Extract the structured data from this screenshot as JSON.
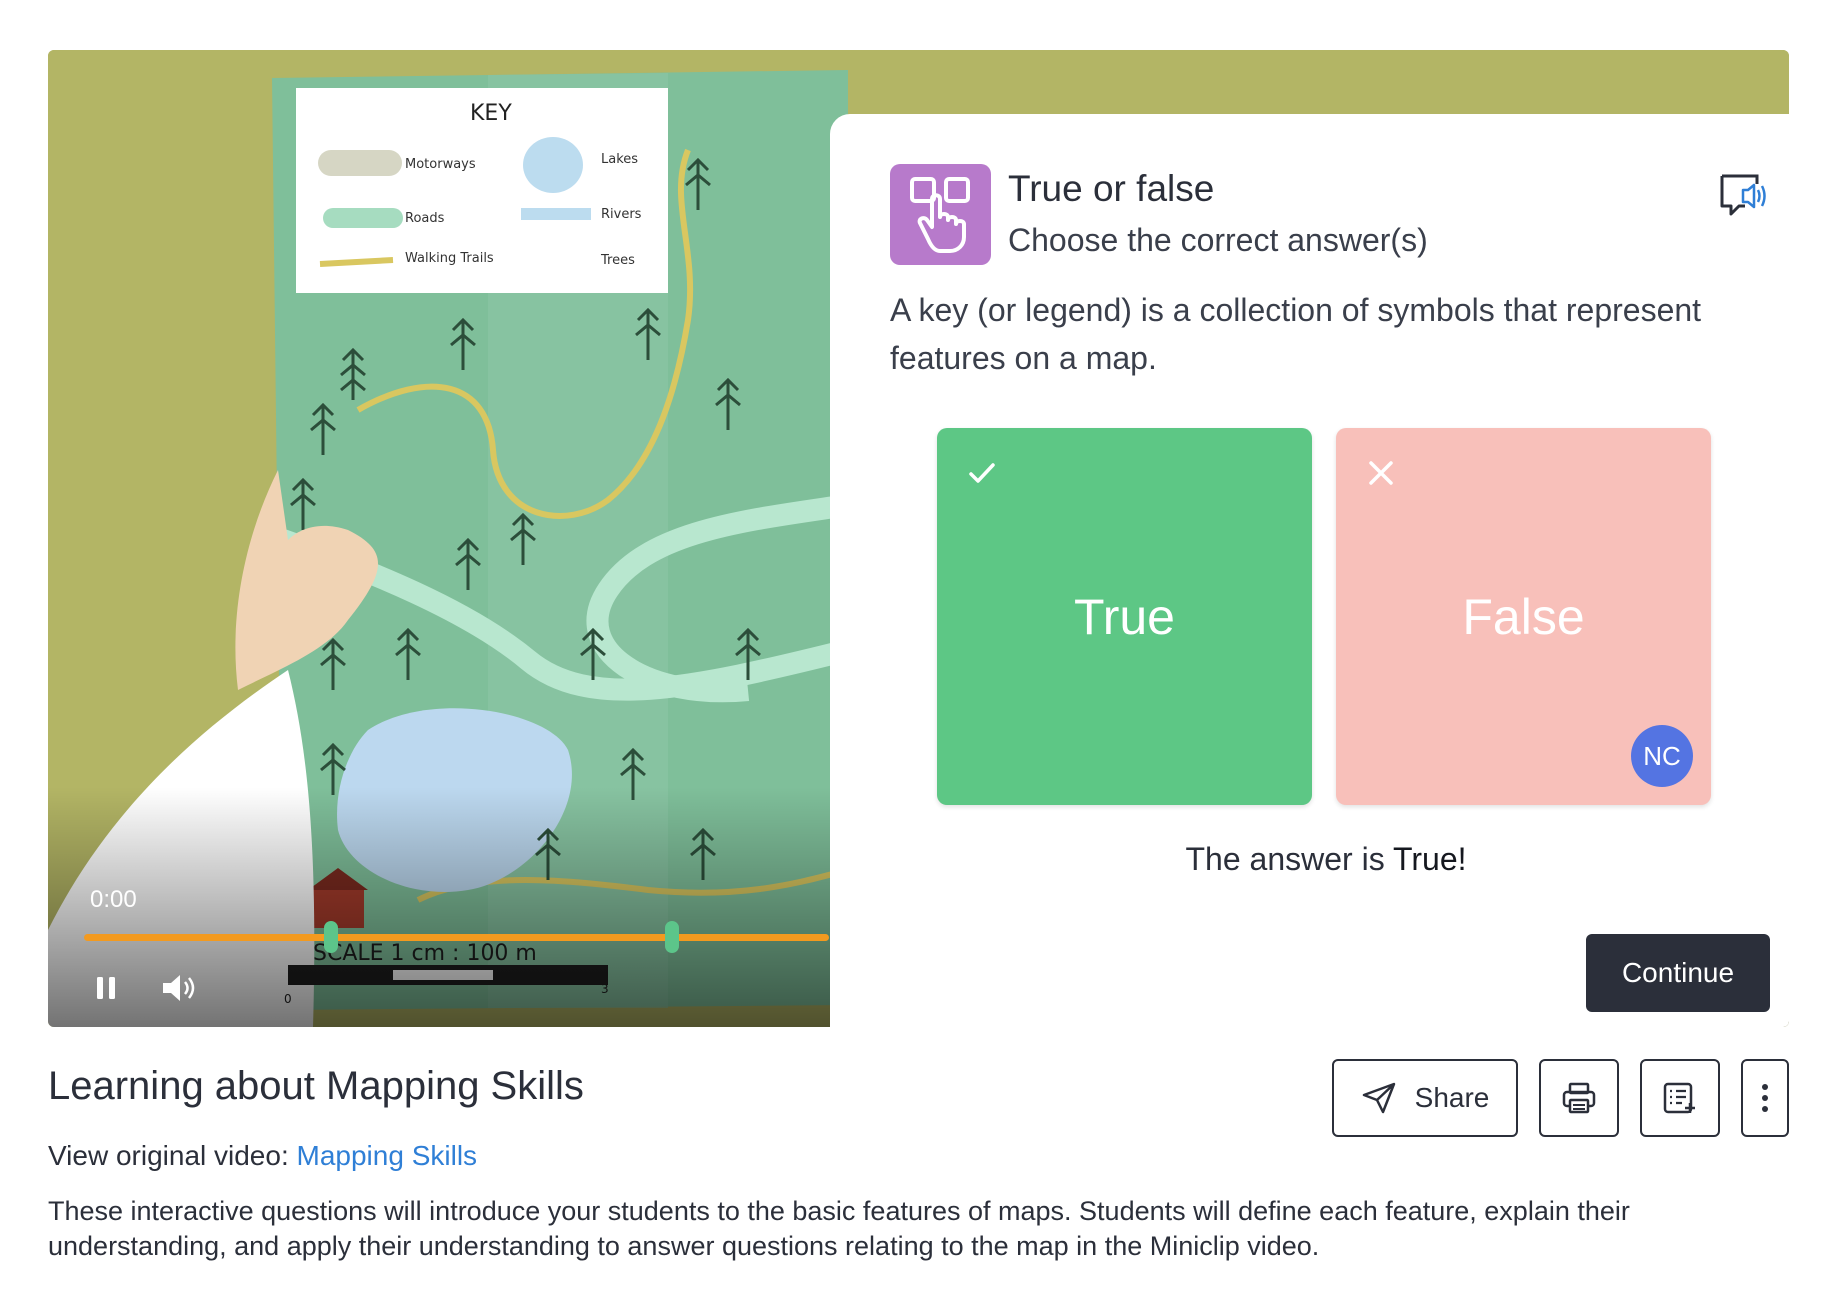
{
  "player": {
    "current_time": "0:00",
    "progress": 0,
    "question_markers": 2,
    "controls": {
      "pause_icon": "pause-icon",
      "volume_icon": "volume-icon"
    },
    "map_key": {
      "heading": "KEY",
      "items": [
        "Motorways",
        "Lakes",
        "Roads",
        "Rivers",
        "Walking Trails",
        "Trees"
      ]
    },
    "map_scale": {
      "label": "SCALE 1 cm : 100 m",
      "start": "0",
      "end": "3"
    }
  },
  "question": {
    "type": "True or false",
    "instruction": "Choose the correct answer(s)",
    "text": "A key (or legend) is a collection of symbols that represent features on a map.",
    "options": [
      {
        "label": "True",
        "mark": "check-icon",
        "color": "#5dc785"
      },
      {
        "label": "False",
        "mark": "close-icon",
        "color": "#f8c0ba",
        "avatar": "NC"
      }
    ],
    "result_prefix": "The answer is ",
    "result_answer": "True!",
    "continue_label": "Continue",
    "icon": "tap-choice-icon",
    "audio_icon": "read-aloud-icon"
  },
  "details": {
    "title": "Learning about Mapping Skills",
    "original_prefix": "View original video:",
    "original_link": "Mapping Skills",
    "description": "These interactive questions will introduce your students to the basic features of maps. Students will define each feature, explain their understanding, and apply their understanding to answer questions relating to the map in the Miniclip video."
  },
  "actions": {
    "share_label": "Share",
    "share_icon": "send-icon",
    "print_icon": "print-icon",
    "add_list_icon": "add-to-list-icon",
    "more_icon": "more-vertical-icon"
  },
  "colors": {
    "accent_dark": "#2b2f3a",
    "link": "#2f7fd6",
    "progress": "#f39a1f",
    "true": "#5dc785",
    "false": "#f8c0ba",
    "avatar": "#5474e2",
    "question_icon_bg": "#b77acb"
  }
}
